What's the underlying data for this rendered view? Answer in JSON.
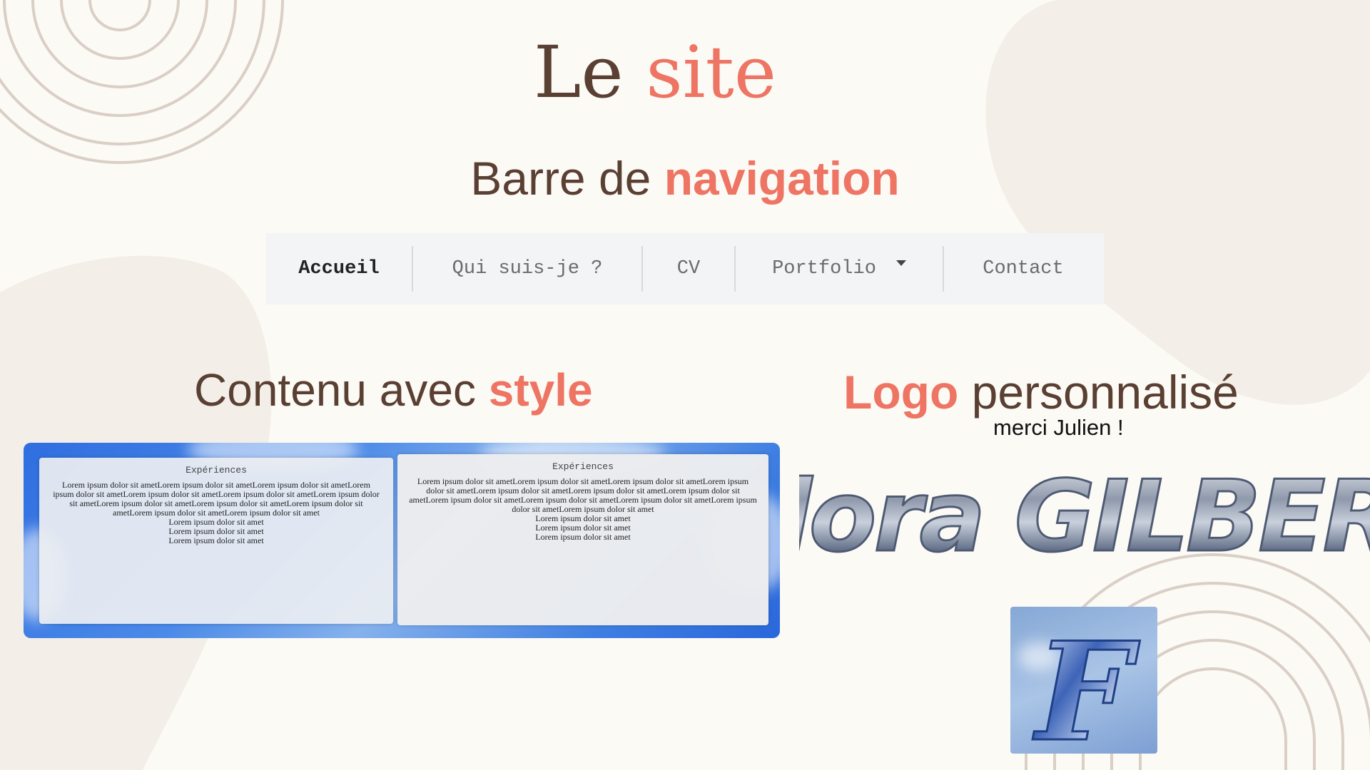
{
  "slide": {
    "title_part1": "Le",
    "title_part2": "site",
    "nav_heading_part1": "Barre de",
    "nav_heading_part2": "navigation",
    "content_heading_part1": "Contenu avec",
    "content_heading_part2": "style",
    "logo_heading_part1": "Logo",
    "logo_heading_part2": "personnalisé",
    "logo_thanks": "merci Julien !"
  },
  "navbar": {
    "items": [
      {
        "label": "Accueil",
        "active": true
      },
      {
        "label": "Qui suis-je ?"
      },
      {
        "label": "CV"
      },
      {
        "label": "Portfolio",
        "dropdown": true
      },
      {
        "label": "Contact"
      }
    ]
  },
  "preview": {
    "cards": [
      {
        "title": "Expériences",
        "body": "Lorem ipsum dolor sit ametLorem ipsum dolor sit ametLorem ipsum dolor sit ametLorem ipsum dolor sit ametLorem ipsum dolor sit ametLorem ipsum dolor sit ametLorem ipsum dolor sit ametLorem ipsum dolor sit ametLorem ipsum dolor sit ametLorem ipsum dolor sit ametLorem ipsum dolor sit ametLorem ipsum dolor sit amet",
        "lines": [
          "Lorem ipsum dolor sit amet",
          "Lorem ipsum dolor sit amet",
          "Lorem ipsum dolor sit amet"
        ]
      },
      {
        "title": "Expériences",
        "body": "Lorem ipsum dolor sit ametLorem ipsum dolor sit ametLorem ipsum dolor sit ametLorem ipsum dolor sit ametLorem ipsum dolor sit ametLorem ipsum dolor sit ametLorem ipsum dolor sit ametLorem ipsum dolor sit ametLorem ipsum dolor sit ametLorem ipsum dolor sit ametLorem ipsum dolor sit ametLorem ipsum dolor sit amet",
        "lines": [
          "Lorem ipsum dolor sit amet",
          "Lorem ipsum dolor sit amet",
          "Lorem ipsum dolor sit amet"
        ]
      }
    ]
  },
  "logo": {
    "text": "Flora GILBERT",
    "monogram": "F"
  },
  "colors": {
    "background": "#fcfaf5",
    "heading_brown": "#5a3f33",
    "accent_coral": "#ee7463",
    "blob": "#f3efe8",
    "arc_lines": "#d9cfc6",
    "navbar_bg": "#f3f4f5"
  }
}
